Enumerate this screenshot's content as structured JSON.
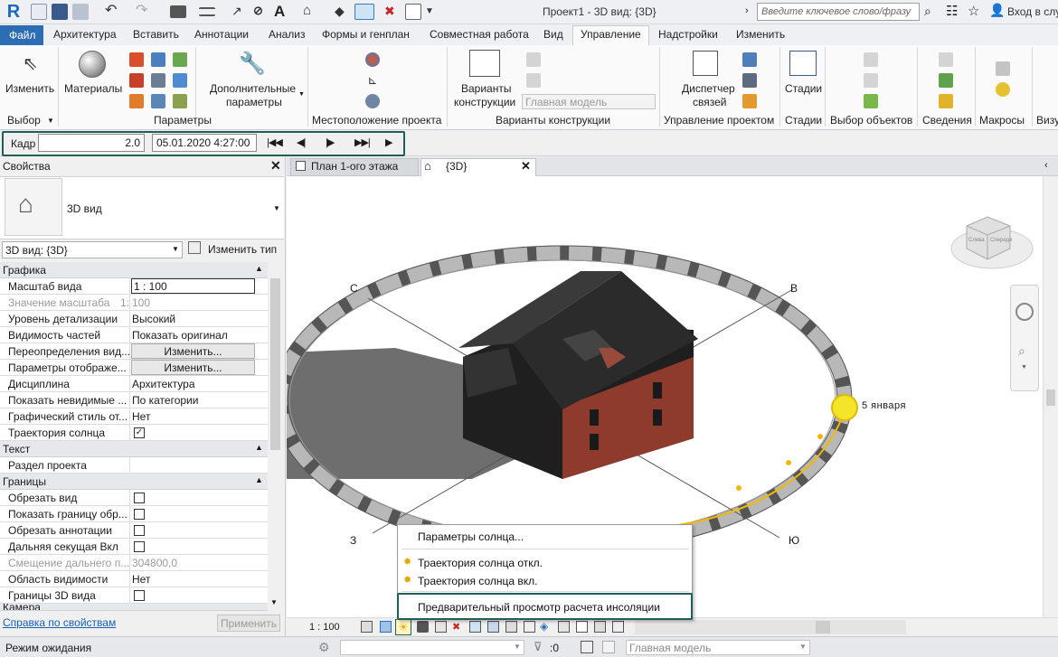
{
  "titlebar": {
    "app_logo": "R",
    "document_title": "Проект1 - 3D вид: {3D}",
    "search_placeholder": "Введите ключевое слово/фразу",
    "sign_in": "Вход в слу"
  },
  "tabs": [
    "Файл",
    "Архитектура",
    "Вставить",
    "Аннотации",
    "Анализ",
    "Формы и генплан",
    "Совместная работа",
    "Вид",
    "Управление",
    "Надстройки",
    "Изменить"
  ],
  "active_tab": "Управление",
  "ribbon": {
    "modify_label": "Изменить",
    "materials_label": "Материалы",
    "additional_params_label_1": "Дополнительные",
    "additional_params_label_2": "параметры",
    "design_options_label_1": "Варианты",
    "design_options_label_2": "конструкции",
    "main_model_dropdown": "Главная модель",
    "manage_links_label_1": "Диспетчер",
    "manage_links_label_2": "связей",
    "phases_label": "Стадии",
    "groups": {
      "selection": "Выбор",
      "parameters": "Параметры",
      "project_location": "Местоположение проекта",
      "design_options": "Варианты конструкции",
      "project_management": "Управление проектом",
      "phases": "Стадии",
      "select_objects": "Выбор объектов",
      "info": "Сведения",
      "macros": "Макросы",
      "visual": "Визу"
    }
  },
  "options_bar": {
    "frame_label": "Кадр",
    "frame_value": "2.0",
    "datetime": "05.01.2020 4:27:00"
  },
  "properties": {
    "title": "Свойства",
    "type_name": "3D вид",
    "instance_selector": "3D вид: {3D}",
    "edit_type": "Изменить тип",
    "sections": {
      "graphics": "Графика",
      "text": "Текст",
      "extents": "Границы",
      "camera": "Камера"
    },
    "rows_graphics": [
      {
        "name": "Масштаб вида",
        "value": "1 : 100"
      },
      {
        "name": "Значение масштаба",
        "value": "100",
        "short": "1:"
      },
      {
        "name": "Уровень детализации",
        "value": "Высокий"
      },
      {
        "name": "Видимость частей",
        "value": "Показать оригинал"
      },
      {
        "name": "Переопределения вид...",
        "value": "Изменить..."
      },
      {
        "name": "Параметры отображе...",
        "value": "Изменить..."
      },
      {
        "name": "Дисциплина",
        "value": "Архитектура"
      },
      {
        "name": "Показать невидимые ...",
        "value": "По категории"
      },
      {
        "name": "Графический стиль от...",
        "value": "Нет"
      },
      {
        "name": "Траектория солнца",
        "value": "✓"
      }
    ],
    "rows_text": [
      {
        "name": "Раздел проекта",
        "value": ""
      }
    ],
    "rows_extents": [
      {
        "name": "Обрезать вид",
        "value": ""
      },
      {
        "name": "Показать границу обр...",
        "value": ""
      },
      {
        "name": "Обрезать аннотации",
        "value": ""
      },
      {
        "name": "Дальняя секущая Вкл",
        "value": ""
      },
      {
        "name": "Смещение дальнего п...",
        "value": "304800,0"
      },
      {
        "name": "Область видимости",
        "value": "Нет"
      },
      {
        "name": "Границы 3D вида",
        "value": ""
      }
    ],
    "help_link": "Справка по свойствам",
    "apply_button": "Применить"
  },
  "view_tabs": [
    {
      "label": "План 1-ого этажа"
    },
    {
      "label": "{3D}"
    }
  ],
  "viewport": {
    "compass": {
      "north": "С",
      "east": "В",
      "south": "Ю",
      "west": "З"
    },
    "sun_date_label": "5 января",
    "viewcube_labels": [
      "Слева",
      "Спереди"
    ]
  },
  "view_control_bar": {
    "scale": "1 : 100"
  },
  "context_menu": {
    "items": [
      "Параметры солнца...",
      "Траектория солнца откл.",
      "Траектория солнца вкл.",
      "Предварительный просмотр расчета инсоляции"
    ]
  },
  "statusbar": {
    "status_text": "Режим ожидания",
    "counter": ":0",
    "model_dropdown": "Главная модель"
  },
  "colors": {
    "file_tab": "#2d6db5",
    "highlight_frame": "#1f5f56",
    "sun_path": "#f2b800",
    "roof": "#2b2b2b",
    "brick": "#8e3a2c"
  }
}
